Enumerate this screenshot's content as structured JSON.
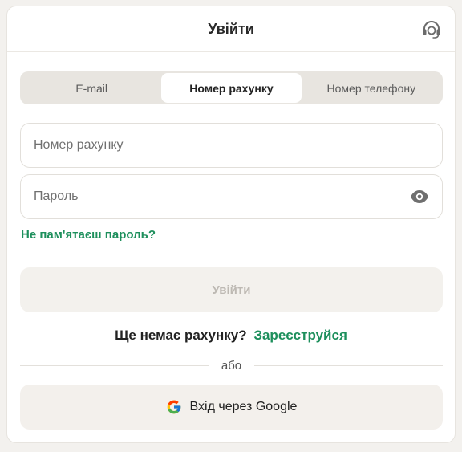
{
  "header": {
    "title": "Увійти",
    "support_icon": "headset-icon"
  },
  "tabs": [
    {
      "label": "E-mail",
      "active": false
    },
    {
      "label": "Номер рахунку",
      "active": true
    },
    {
      "label": "Номер телефону",
      "active": false
    }
  ],
  "form": {
    "account_placeholder": "Номер рахунку",
    "account_value": "",
    "password_placeholder": "Пароль",
    "password_value": "",
    "show_password_icon": "eye-icon",
    "forgot_password": "Не пам'ятаєш пароль?",
    "login_button": "Увійти"
  },
  "signup": {
    "question": "Ще немає рахунку?",
    "link": "Зареєструйся"
  },
  "divider": {
    "text": "або"
  },
  "google": {
    "label": "Вхід через Google",
    "icon": "google-icon"
  },
  "colors": {
    "accent": "#1d8f5c",
    "tab_bg": "#e8e5e0",
    "button_bg": "#f3f1ed",
    "button_disabled_text": "#bdb9b3"
  }
}
